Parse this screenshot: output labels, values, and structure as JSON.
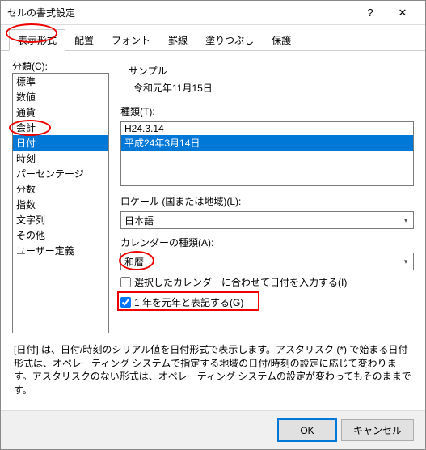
{
  "title": "セルの書式設定",
  "tabs": [
    "表示形式",
    "配置",
    "フォント",
    "罫線",
    "塗りつぶし",
    "保護"
  ],
  "active_tab": 0,
  "category_label": "分類(C):",
  "categories": [
    "標準",
    "数値",
    "通貨",
    "会計",
    "日付",
    "時刻",
    "パーセンテージ",
    "分数",
    "指数",
    "文字列",
    "その他",
    "ユーザー定義"
  ],
  "selected_category": 4,
  "sample_label": "サンプル",
  "sample_value": "令和元年11月15日",
  "type_label": "種類(T):",
  "types": [
    "H24.3.14",
    "平成24年3月14日"
  ],
  "selected_type": 1,
  "locale_label": "ロケール (国または地域)(L):",
  "locale_value": "日本語",
  "calendar_label": "カレンダーの種類(A):",
  "calendar_value": "和暦",
  "chk1_label": "選択したカレンダーに合わせて日付を入力する(I)",
  "chk1_checked": false,
  "chk2_label": "1 年を元年と表記する(G)",
  "chk2_checked": true,
  "description": "[日付] は、日付/時刻のシリアル値を日付形式で表示します。アスタリスク (*) で始まる日付形式は、オペレーティング システムで指定する地域の日付/時刻の設定に応じて変わります。アスタリスクのない形式は、オペレーティング システムの設定が変わってもそのままです。",
  "ok_label": "OK",
  "cancel_label": "キャンセル"
}
